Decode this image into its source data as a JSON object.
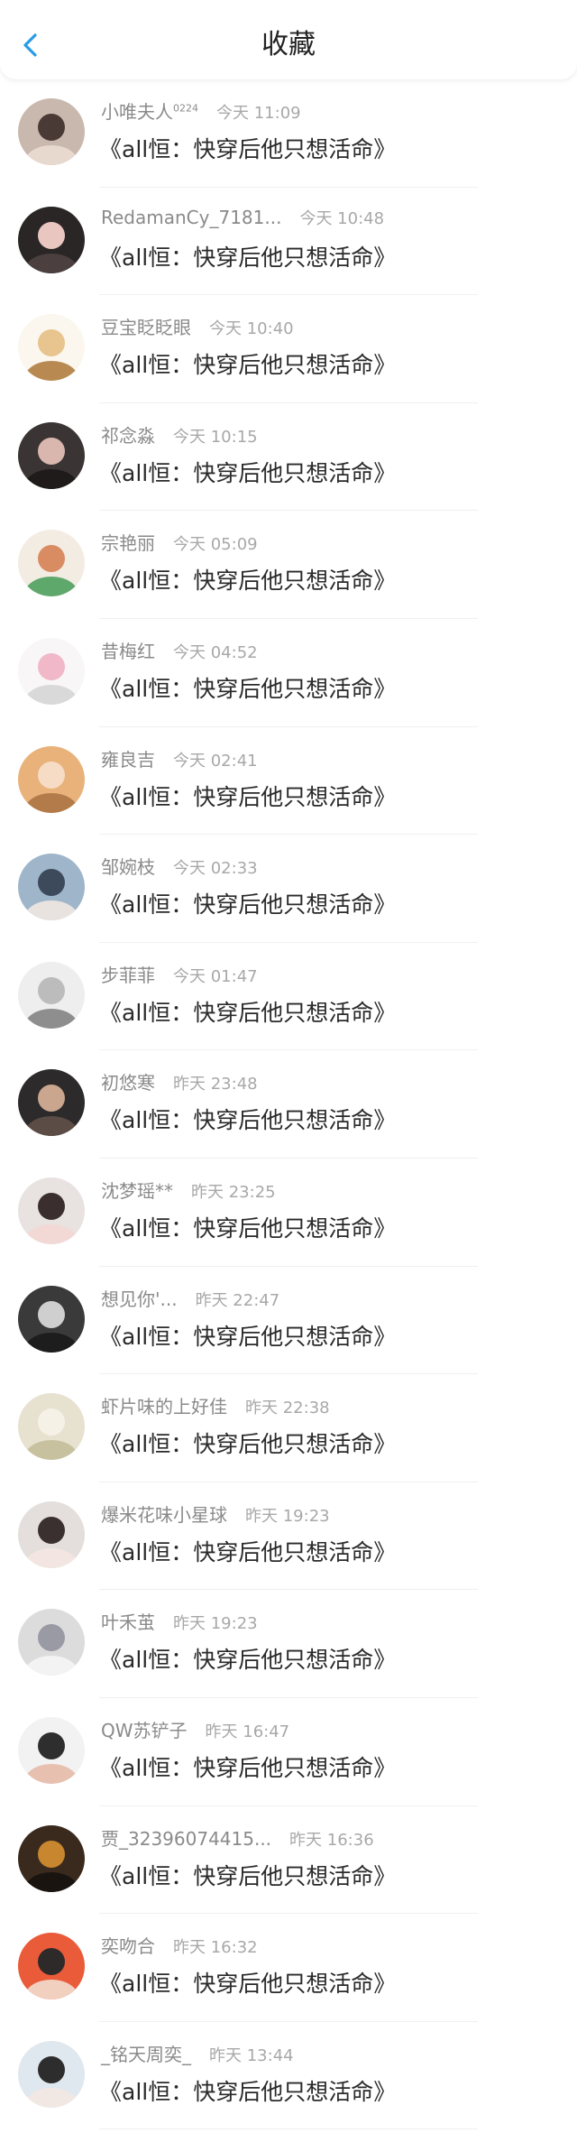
{
  "header": {
    "title": "收藏"
  },
  "colors": {
    "accent": "#2a9be6",
    "name": "#8a8a8a",
    "time": "#a8a8a8",
    "text": "#2a2a2a"
  },
  "items": [
    {
      "name": "小唯夫人",
      "superscript": "0224",
      "time": "今天 11:09",
      "text": "《all恒：快穿后他只想活命》",
      "avatar_icon": "user-avatar-icon"
    },
    {
      "name": "RedamanCy_7181...",
      "superscript": "",
      "time": "今天 10:48",
      "text": "《all恒：快穿后他只想活命》",
      "avatar_icon": "user-avatar-icon"
    },
    {
      "name": "豆宝眨眨眼",
      "superscript": "",
      "time": "今天 10:40",
      "text": "《all恒：快穿后他只想活命》",
      "avatar_icon": "user-avatar-icon"
    },
    {
      "name": "祁念淼",
      "superscript": "",
      "time": "今天 10:15",
      "text": "《all恒：快穿后他只想活命》",
      "avatar_icon": "user-avatar-icon"
    },
    {
      "name": "宗艳丽",
      "superscript": "",
      "time": "今天 05:09",
      "text": "《all恒：快穿后他只想活命》",
      "avatar_icon": "user-avatar-icon"
    },
    {
      "name": "昔梅红",
      "superscript": "",
      "time": "今天 04:52",
      "text": "《all恒：快穿后他只想活命》",
      "avatar_icon": "user-avatar-icon"
    },
    {
      "name": "雍良吉",
      "superscript": "",
      "time": "今天 02:41",
      "text": "《all恒：快穿后他只想活命》",
      "avatar_icon": "user-avatar-icon"
    },
    {
      "name": "邹婉枝",
      "superscript": "",
      "time": "今天 02:33",
      "text": "《all恒：快穿后他只想活命》",
      "avatar_icon": "user-avatar-icon"
    },
    {
      "name": "步菲菲",
      "superscript": "",
      "time": "今天 01:47",
      "text": "《all恒：快穿后他只想活命》",
      "avatar_icon": "user-avatar-icon"
    },
    {
      "name": "初悠寒",
      "superscript": "",
      "time": "昨天 23:48",
      "text": "《all恒：快穿后他只想活命》",
      "avatar_icon": "user-avatar-icon"
    },
    {
      "name": "沈梦瑶**",
      "superscript": "",
      "time": "昨天 23:25",
      "text": "《all恒：快穿后他只想活命》",
      "avatar_icon": "user-avatar-icon"
    },
    {
      "name": "想见你'...",
      "superscript": "",
      "time": "昨天 22:47",
      "text": "《all恒：快穿后他只想活命》",
      "avatar_icon": "user-avatar-icon"
    },
    {
      "name": "虾片味的上好佳",
      "superscript": "",
      "time": "昨天 22:38",
      "text": "《all恒：快穿后他只想活命》",
      "avatar_icon": "user-avatar-icon"
    },
    {
      "name": "爆米花味小星球",
      "superscript": "",
      "time": "昨天 19:23",
      "text": "《all恒：快穿后他只想活命》",
      "avatar_icon": "user-avatar-icon"
    },
    {
      "name": "叶禾茧",
      "superscript": "",
      "time": "昨天 19:23",
      "text": "《all恒：快穿后他只想活命》",
      "avatar_icon": "user-avatar-icon"
    },
    {
      "name": "QW苏铲子",
      "superscript": "",
      "time": "昨天 16:47",
      "text": "《all恒：快穿后他只想活命》",
      "avatar_icon": "user-avatar-icon"
    },
    {
      "name": "贾_32396074415...",
      "superscript": "",
      "time": "昨天 16:36",
      "text": "《all恒：快穿后他只想活命》",
      "avatar_icon": "user-avatar-icon"
    },
    {
      "name": "奕吻合",
      "superscript": "",
      "time": "昨天 16:32",
      "text": "《all恒：快穿后他只想活命》",
      "avatar_icon": "user-avatar-icon"
    },
    {
      "name": "_铭天周奕_",
      "superscript": "",
      "time": "昨天 13:44",
      "text": "《all恒：快穿后他只想活命》",
      "avatar_icon": "user-avatar-icon"
    }
  ]
}
